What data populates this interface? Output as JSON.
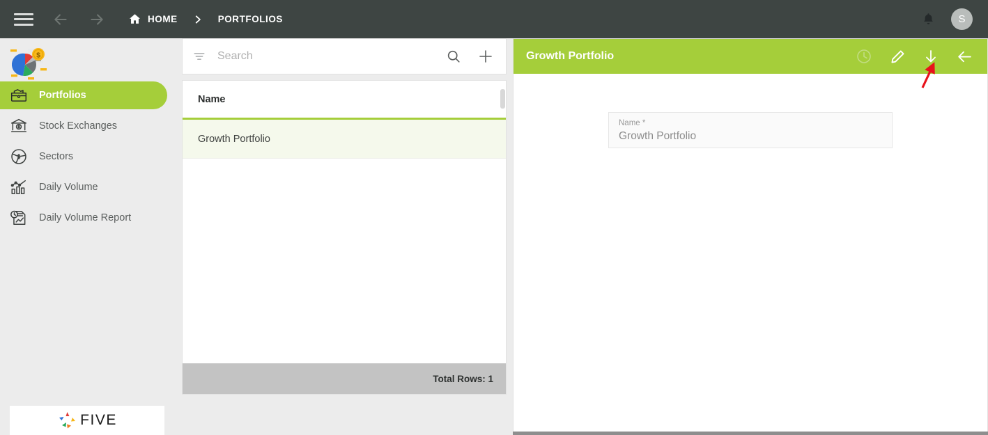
{
  "topbar": {
    "menu_icon": "hamburger-icon",
    "back_icon": "arrow-left-icon",
    "forward_icon": "arrow-right-icon",
    "home_icon": "home-icon",
    "home_label": "HOME",
    "separator": "›",
    "current_label": "PORTFOLIOS",
    "bell_icon": "bell-icon",
    "avatar_initial": "S"
  },
  "sidebar": {
    "logo_icon": "pie-chart-money-logo",
    "items": [
      {
        "label": "Portfolios",
        "icon": "briefcase-money-icon",
        "active": true
      },
      {
        "label": "Stock Exchanges",
        "icon": "bank-dollar-icon",
        "active": false
      },
      {
        "label": "Sectors",
        "icon": "pie-chart-dollar-icon",
        "active": false
      },
      {
        "label": "Daily Volume",
        "icon": "bar-chart-line-icon",
        "active": false
      },
      {
        "label": "Daily Volume Report",
        "icon": "report-clock-chart-icon",
        "active": false
      }
    ],
    "footer_brand": "FIVE"
  },
  "list": {
    "search_placeholder": "Search",
    "search_value": "",
    "filter_icon": "filter-icon",
    "search_icon": "search-icon",
    "add_icon": "plus-icon",
    "columns": [
      "Name"
    ],
    "rows": [
      {
        "name": "Growth Portfolio",
        "selected": true
      }
    ],
    "footer_text": "Total Rows: 1"
  },
  "detail": {
    "title": "Growth Portfolio",
    "actions": [
      {
        "name": "history-clock-icon",
        "label": "History"
      },
      {
        "name": "edit-pencil-icon",
        "label": "Edit"
      },
      {
        "name": "download-arrow-icon",
        "label": "Download"
      },
      {
        "name": "back-arrow-icon",
        "label": "Back"
      }
    ],
    "form": {
      "name_label": "Name *",
      "name_value": "Growth Portfolio"
    }
  },
  "annotation": {
    "arrow_color": "#e8121b",
    "points_at": "download-arrow-icon"
  },
  "colors": {
    "accent_green": "#a5ce3a",
    "topbar_dark": "#3e4543",
    "row_selected": "#f5f9ec",
    "footer_gray": "#c3c3c3"
  }
}
